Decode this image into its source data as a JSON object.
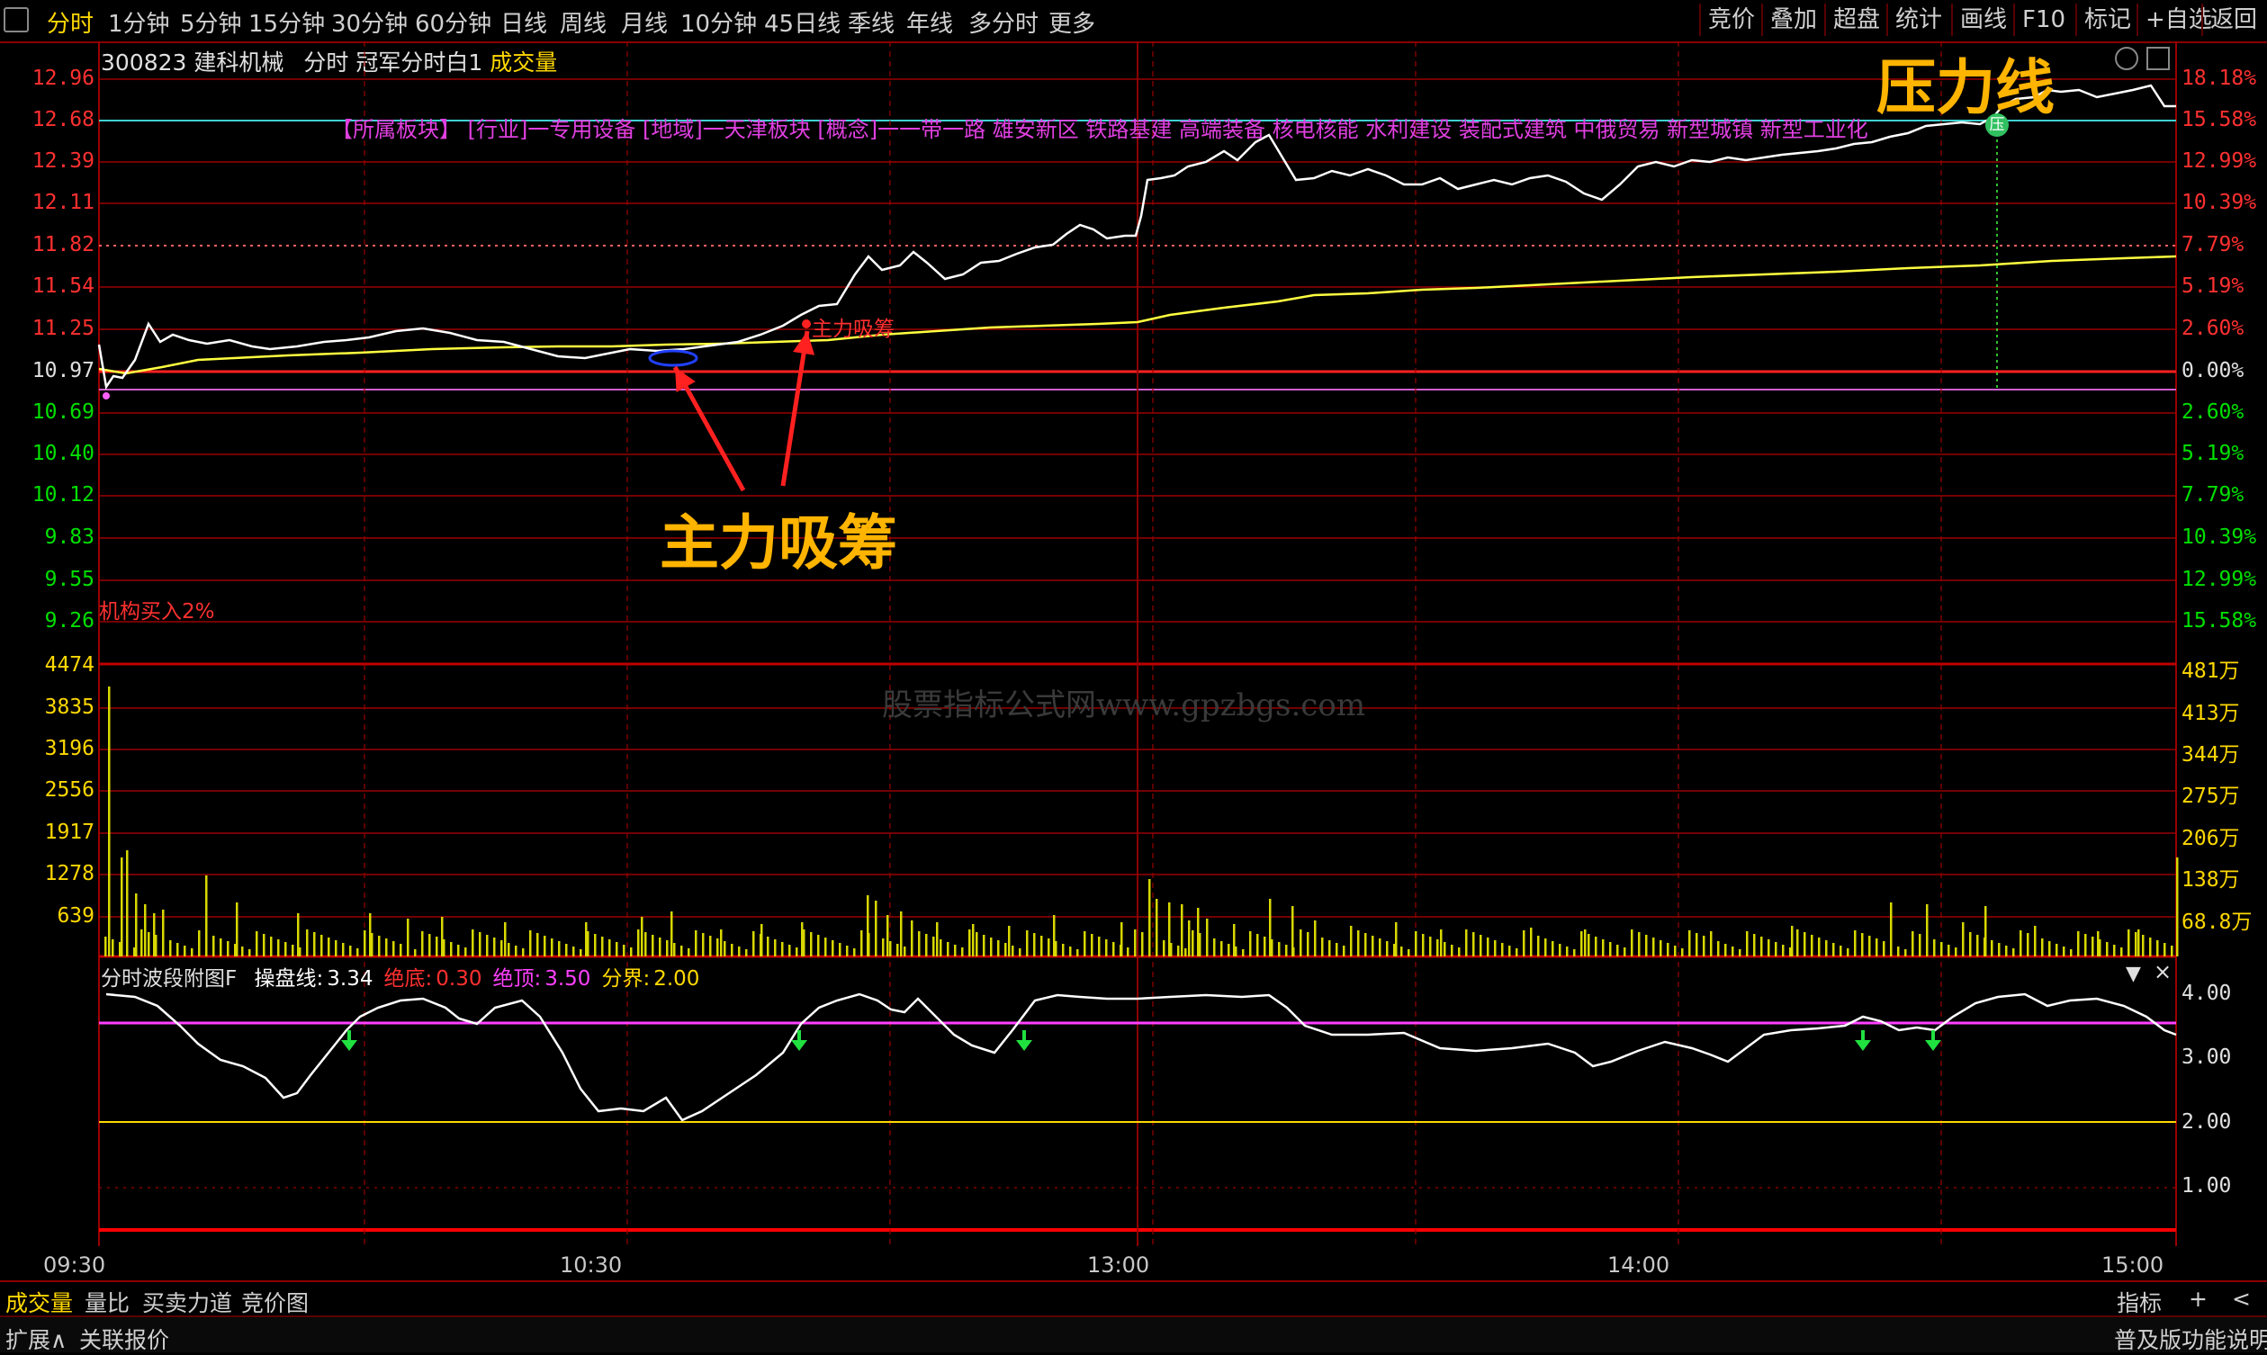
{
  "toolbar": {
    "periods": [
      "分时",
      "1分钟",
      "5分钟",
      "15分钟",
      "30分钟",
      "60分钟",
      "日线",
      "周线",
      "月线",
      "10分钟",
      "45日线",
      "季线",
      "年线",
      "多分时",
      "更多"
    ],
    "right_buttons": [
      "竞价",
      "叠加",
      "超盘",
      "统计",
      "画线",
      "F10",
      "标记",
      "+自选",
      "返回"
    ]
  },
  "info": {
    "code": "300823",
    "name": "建科机械",
    "mode": "分时",
    "indicator": "冠军分时白1",
    "volume_label": "成交量"
  },
  "sectors": "【所属板块】  [行业]一专用设备  [地域]一天津板块  [概念]一一带一路 雄安新区 铁路基建 高端装备 核电核能 水利建设 装配式建筑 中俄贸易 新型城镇 新型工业化",
  "price_axis": {
    "left": [
      "12.96",
      "12.68",
      "12.39",
      "12.11",
      "11.82",
      "11.54",
      "11.25",
      "10.97",
      "10.69",
      "10.40",
      "10.12",
      "9.83",
      "9.55",
      "9.26"
    ],
    "right": [
      "18.18%",
      "15.58%",
      "12.99%",
      "10.39%",
      "7.79%",
      "5.19%",
      "2.60%",
      "0.00%",
      "2.60%",
      "5.19%",
      "7.79%",
      "10.39%",
      "12.99%",
      "15.58%"
    ]
  },
  "volume_axis": {
    "left": [
      "4474",
      "3835",
      "3196",
      "2556",
      "1917",
      "1278",
      "639"
    ],
    "right": [
      "481万",
      "413万",
      "344万",
      "275万",
      "206万",
      "138万",
      "68.8万"
    ]
  },
  "osc_axis": {
    "right": [
      "4.00",
      "3.00",
      "2.00",
      "1.00"
    ]
  },
  "time_axis": [
    "09:30",
    "10:30",
    "13:00",
    "14:00",
    "15:00"
  ],
  "annotations": {
    "inst_buy": "机构买入2%",
    "accum_small": "主力吸筹",
    "accum_big": "主力吸筹",
    "resistance": "压力线",
    "resistance_marker": "压",
    "watermark": "股票指标公式网www.gpzbgs.com"
  },
  "oscillator": {
    "name": "分时波段附图F",
    "items": [
      {
        "label": "操盘线:",
        "value": "3.34",
        "color": "#ffffff"
      },
      {
        "label": "绝底:",
        "value": "0.30",
        "color": "#ff3030"
      },
      {
        "label": "绝顶:",
        "value": "3.50",
        "color": "#ff40ff"
      },
      {
        "label": "分界:",
        "value": "2.00",
        "color": "#ffd800"
      }
    ]
  },
  "bottom_tabs": [
    "成交量",
    "量比",
    "买卖力道",
    "竞价图"
  ],
  "bottom_right": [
    "指标",
    "+",
    "<"
  ],
  "status": {
    "left1": "扩展∧",
    "left2": "关联报价",
    "right": "普及版功能说明"
  },
  "colors": {
    "grid": "#9a0000",
    "price_line": "#ffffff",
    "avg_line": "#ffff40",
    "volume_bar": "#d8d800",
    "boundary": "#ff40ff",
    "divider": "#ffd800",
    "accent": "#ffb400"
  }
}
